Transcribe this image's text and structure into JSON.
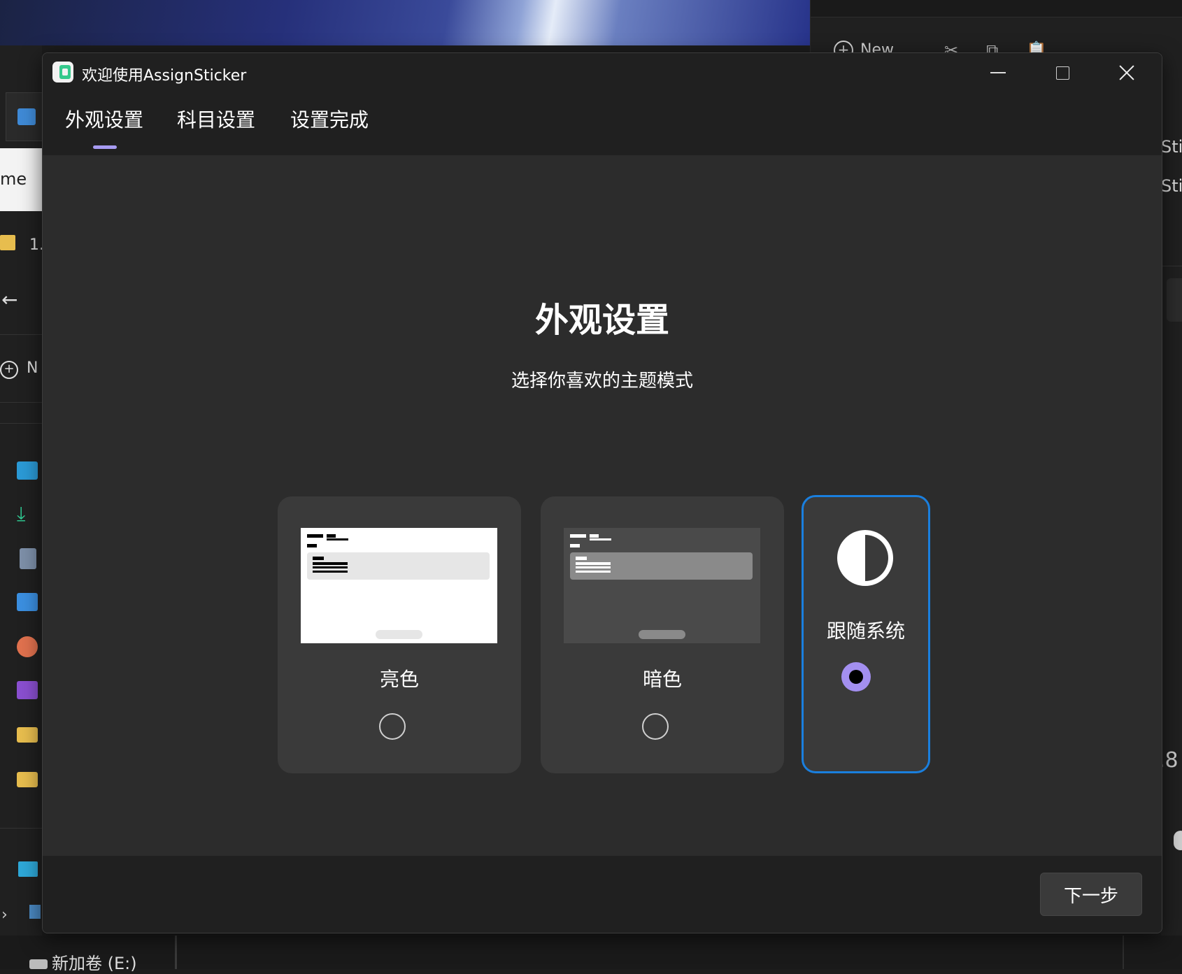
{
  "window": {
    "title": "欢迎使用AssignSticker",
    "icon": "app-icon",
    "controls": [
      "minimize-icon",
      "maximize-icon",
      "close-icon"
    ]
  },
  "tabs": [
    {
      "label": "外观设置",
      "selected": true
    },
    {
      "label": "科目设置",
      "selected": false
    },
    {
      "label": "设置完成",
      "selected": false
    }
  ],
  "main": {
    "title": "外观设置",
    "subtitle": "选择你喜欢的主题模式"
  },
  "theme_options": [
    {
      "label": "亮色",
      "selected": false
    },
    {
      "label": "暗色",
      "selected": false
    },
    {
      "label": "跟随系统",
      "selected": true,
      "icon": "half-circle-contrast-icon"
    }
  ],
  "footer": {
    "next_label": "下一步"
  },
  "colors": {
    "accent_indicator": "#a79bf2",
    "selected_border": "#1a7fde",
    "radio_selected": "#a38ff0",
    "dialog_bg": "#2c2c2c",
    "titlebar_bg": "#202020",
    "card_bg": "#3a3a3a"
  },
  "background": {
    "explorer_new_label": "New",
    "left_home_label": "me",
    "left_folder_label": "1.",
    "left_new_label": "N",
    "right_label_1": "Sti",
    "right_label_2": "Sti",
    "right_number": ".8",
    "drive_label": "新加卷 (E:)"
  }
}
